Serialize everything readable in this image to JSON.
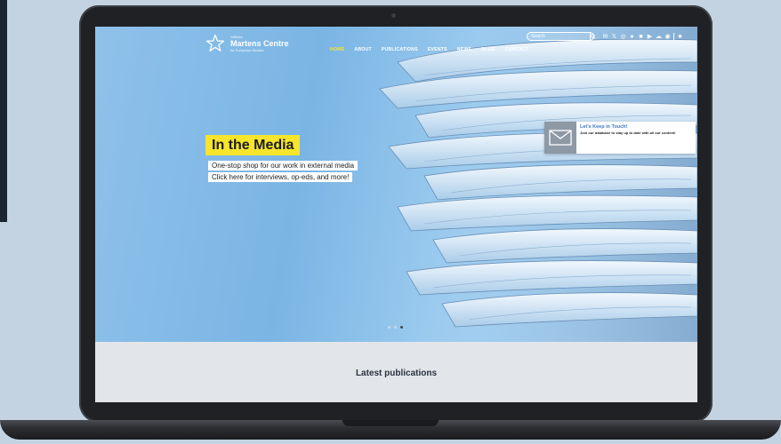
{
  "brand": {
    "small_top": "Wilfried",
    "name": "Martens Centre",
    "tagline": "for European Studies"
  },
  "search": {
    "placeholder": "Search"
  },
  "social_icons": [
    "mail-icon",
    "x-icon",
    "instagram-icon",
    "facebook-icon",
    "linkedin-icon",
    "youtube-icon",
    "soundcloud-icon",
    "spotify-icon",
    "star-icon"
  ],
  "nav": {
    "items": [
      {
        "label": "HOME",
        "active": true
      },
      {
        "label": "ABOUT",
        "active": false
      },
      {
        "label": "PUBLICATIONS",
        "active": false
      },
      {
        "label": "EVENTS",
        "active": false
      },
      {
        "label": "NEWS",
        "active": false
      },
      {
        "label": "BLOG",
        "active": false
      },
      {
        "label": "CONTACT",
        "active": false
      }
    ]
  },
  "hero": {
    "title": "In the Media",
    "line1": "One-stop shop for our work in external media",
    "line2": "Click here for interviews, op-eds, and more!",
    "slide_count": 3,
    "active_slide": 3
  },
  "keep_in_touch": {
    "title": "Let's Keep in Touch!",
    "description": "Join our database to stay up to date with all our content!"
  },
  "latest": {
    "title": "Latest publications"
  },
  "colors": {
    "accent_yellow": "#f6e52c",
    "link_blue": "#3a78c4",
    "background": "#c3d3e1"
  }
}
